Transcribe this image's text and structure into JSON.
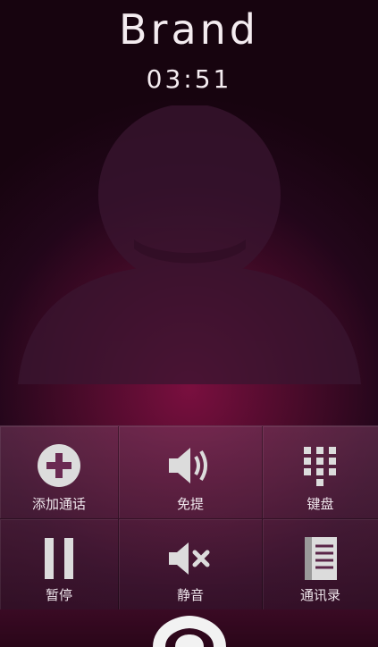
{
  "call": {
    "caller_name": "Brand",
    "duration": "03:51"
  },
  "controls": [
    {
      "label": "添加通话",
      "icon": "add-call-icon"
    },
    {
      "label": "免提",
      "icon": "speaker-icon"
    },
    {
      "label": "键盘",
      "icon": "dialpad-icon"
    },
    {
      "label": "暂停",
      "icon": "pause-icon"
    },
    {
      "label": "静音",
      "icon": "mute-icon"
    },
    {
      "label": "通讯录",
      "icon": "contacts-icon"
    }
  ],
  "end_call": {
    "icon": "end-call-icon"
  },
  "colors": {
    "background": "#4a0b2a",
    "accent": "#7a0f3f",
    "icon": "#dcdcdc"
  }
}
